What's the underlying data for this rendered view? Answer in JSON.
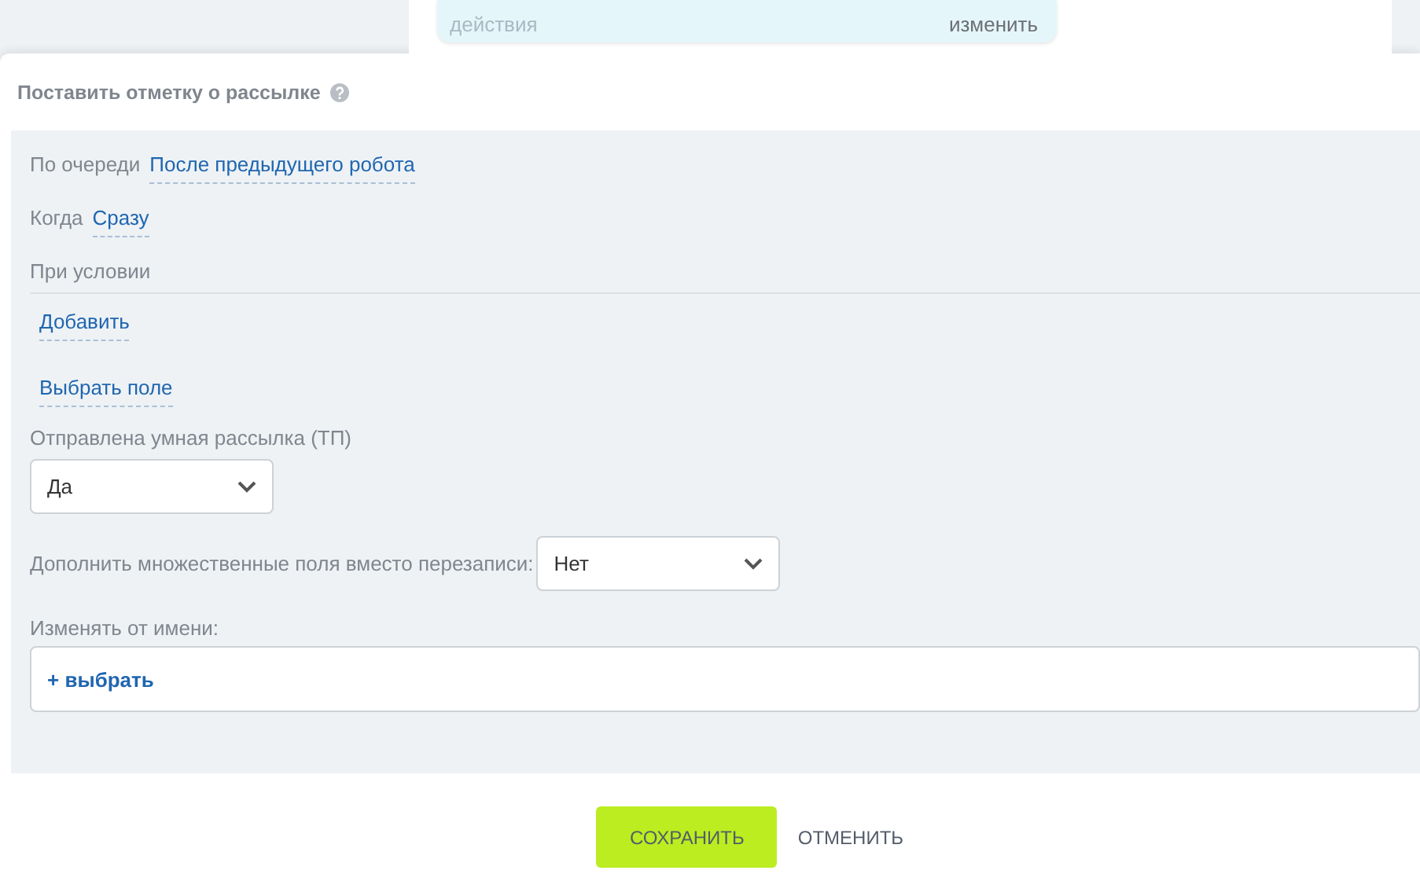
{
  "background_card": {
    "text": "действия",
    "action": "изменить"
  },
  "dialog": {
    "title": "Поставить отметку о рассылке",
    "order": {
      "label": "По очереди",
      "value": "После предыдущего робота"
    },
    "when": {
      "label": "Когда",
      "value": "Сразу"
    },
    "condition": {
      "label": "При условии",
      "add": "Добавить",
      "pick_field": "Выбрать поле"
    },
    "fields": [
      {
        "label": "Отправлена умная рассылка (ТП)",
        "value": "Да",
        "kind": "stacked"
      },
      {
        "label": "Дополнить множественные поля вместо перезаписи:",
        "value": "Нет",
        "kind": "inline"
      }
    ],
    "author": {
      "label": "Изменять от имени:",
      "plus": "+",
      "action": "выбрать"
    },
    "buttons": [
      {
        "label": "СОХРАНИТЬ",
        "kind": "primary"
      },
      {
        "label": "ОТМЕНИТЬ",
        "kind": "plain"
      }
    ]
  }
}
